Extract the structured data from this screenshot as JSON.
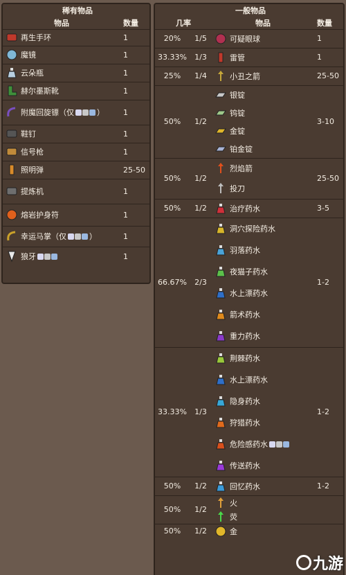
{
  "rare": {
    "title": "稀有物品",
    "col_item": "物品",
    "col_qty": "数量",
    "rows": [
      {
        "name": "再生手环",
        "qty": "1",
        "icon": "bracelet-icon"
      },
      {
        "name": "魔镜",
        "qty": "1",
        "icon": "mirror-icon"
      },
      {
        "name": "云朵瓶",
        "qty": "1",
        "icon": "bottle-icon"
      },
      {
        "name": "赫尔墨斯靴",
        "qty": "1",
        "icon": "boots-icon"
      },
      {
        "name": "附魔回旋镖（仅",
        "suffix": "）",
        "qty": "1",
        "icon": "boomerang-icon"
      },
      {
        "name": "鞋钉",
        "qty": "1",
        "icon": "shoe-spikes-icon"
      },
      {
        "name": "信号枪",
        "qty": "1",
        "icon": "flare-gun-icon"
      },
      {
        "name": "照明弹",
        "qty": "25-50",
        "icon": "flare-icon"
      },
      {
        "name": "提炼机",
        "qty": "1",
        "icon": "extractinator-icon"
      },
      {
        "name": "熔岩护身符",
        "qty": "1",
        "icon": "lava-charm-icon"
      },
      {
        "name": "幸运马掌（仅",
        "suffix": "）",
        "qty": "1",
        "icon": "horseshoe-icon"
      },
      {
        "name": "狼牙",
        "qty": "1",
        "icon": "fang-icon"
      }
    ]
  },
  "common": {
    "title": "一般物品",
    "col_rate": "几率",
    "col_item": "物品",
    "col_qty": "数量",
    "groups": [
      {
        "pct": "20%",
        "frac": "1/5",
        "qty": "1",
        "items": [
          {
            "name": "可疑眼球",
            "icon": "eyeball-icon"
          }
        ]
      },
      {
        "pct": "33.33%",
        "frac": "1/3",
        "qty": "1",
        "items": [
          {
            "name": "雷管",
            "icon": "dynamite-icon"
          }
        ]
      },
      {
        "pct": "25%",
        "frac": "1/4",
        "qty": "25-50",
        "items": [
          {
            "name": "小丑之箭",
            "icon": "arrow-icon"
          }
        ]
      },
      {
        "pct": "50%",
        "frac": "1/2",
        "qty": "3-10",
        "items": [
          {
            "name": "银锭",
            "icon": "silver-bar-icon"
          },
          {
            "name": "钨锭",
            "icon": "tungsten-bar-icon"
          },
          {
            "name": "金锭",
            "icon": "gold-bar-icon"
          },
          {
            "name": "铂金锭",
            "icon": "platinum-bar-icon"
          }
        ]
      },
      {
        "pct": "50%",
        "frac": "1/2",
        "qty": "25-50",
        "items": [
          {
            "name": "烈焰箭",
            "icon": "flaming-arrow-icon"
          },
          {
            "name": "投刀",
            "icon": "throwing-knife-icon"
          }
        ]
      },
      {
        "pct": "50%",
        "frac": "1/2",
        "qty": "3-5",
        "items": [
          {
            "name": "治疗药水",
            "icon": "healing-potion-icon"
          }
        ]
      },
      {
        "pct": "66.67%",
        "frac": "2/3",
        "qty": "1-2",
        "items": [
          {
            "name": "洞穴探险药水",
            "icon": "spelunker-potion-icon"
          },
          {
            "name": "羽落药水",
            "icon": "featherfall-potion-icon"
          },
          {
            "name": "夜猫子药水",
            "icon": "night-owl-potion-icon"
          },
          {
            "name": "水上漂药水",
            "icon": "water-walking-potion-icon"
          },
          {
            "name": "箭术药水",
            "icon": "archery-potion-icon"
          },
          {
            "name": "重力药水",
            "icon": "gravitation-potion-icon"
          }
        ]
      },
      {
        "pct": "33.33%",
        "frac": "1/3",
        "qty": "1-2",
        "items": [
          {
            "name": "荆棘药水",
            "icon": "thorns-potion-icon"
          },
          {
            "name": "水上漂药水",
            "icon": "water-walking-potion-icon"
          },
          {
            "name": "隐身药水",
            "icon": "invisibility-potion-icon"
          },
          {
            "name": "狩猎药水",
            "icon": "hunter-potion-icon"
          },
          {
            "name": "危险感药水",
            "icon": "dangersense-potion-icon",
            "has_badges": true
          },
          {
            "name": "传送药水",
            "icon": "teleport-potion-icon"
          }
        ]
      },
      {
        "pct": "50%",
        "frac": "1/2",
        "qty": "1-2",
        "items": [
          {
            "name": "回忆药水",
            "icon": "recall-potion-icon"
          }
        ]
      },
      {
        "pct": "50%",
        "frac": "1/2",
        "qty": "",
        "items": [
          {
            "name": "火",
            "icon": "torch-icon"
          },
          {
            "name": "荧",
            "icon": "glowstick-icon"
          }
        ]
      },
      {
        "pct": "50%",
        "frac": "1/2",
        "qty": "",
        "items": [
          {
            "name": "金",
            "icon": "gold-coin-icon"
          }
        ]
      }
    ]
  },
  "watermark": {
    "text": "九游"
  },
  "colors": {
    "background": "#6b5a4e",
    "panel": "#4a3b31",
    "border": "#2e241d",
    "text": "#f3ece2"
  }
}
